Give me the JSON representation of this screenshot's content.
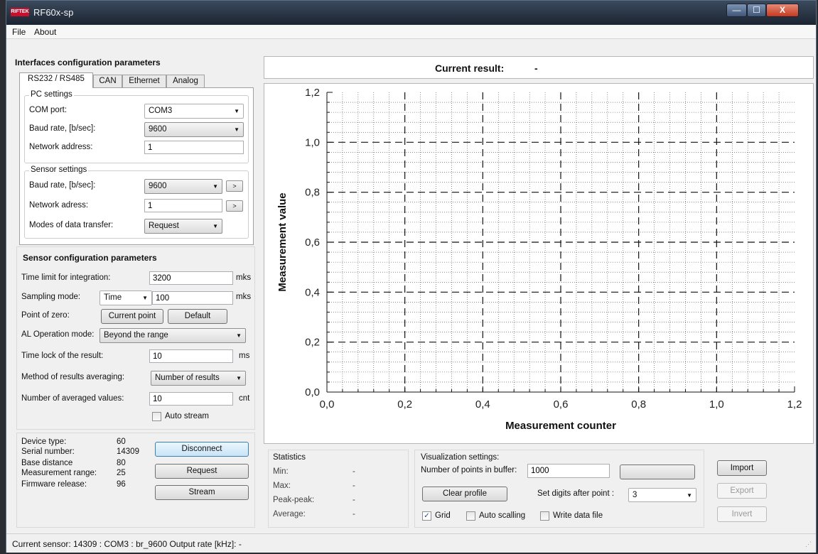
{
  "window": {
    "title": "RF60x-sp",
    "logo_text": "RIFTEK",
    "controls": {
      "min": "—",
      "max": "☐",
      "close": "X"
    }
  },
  "menu": {
    "file": "File",
    "about": "About"
  },
  "interfaces": {
    "heading": "Interfaces configuration parameters",
    "tabs": [
      "RS232 / RS485",
      "CAN",
      "Ethernet",
      "Analog"
    ],
    "pc_settings": {
      "title": "PC settings",
      "com_port_label": "COM port:",
      "com_port_value": "COM3",
      "baud_label": "Baud rate, [b/sec]:",
      "baud_value": "9600",
      "network_address_label": "Network address:",
      "network_address_value": "1"
    },
    "sensor_settings": {
      "title": "Sensor settings",
      "baud_label": "Baud rate, [b/sec]:",
      "baud_value": "9600",
      "network_adress_label": "Network adress:",
      "network_adress_value": "1",
      "modes_label": "Modes of data transfer:",
      "modes_value": "Request",
      "apply_glyph": ">"
    }
  },
  "sensor_config": {
    "heading": "Sensor configuration parameters",
    "time_limit_label": "Time limit for integration:",
    "time_limit_value": "3200",
    "time_limit_unit": "mks",
    "sampling_label": "Sampling mode:",
    "sampling_mode": "Time",
    "sampling_value": "100",
    "sampling_unit": "mks",
    "zero_label": "Point of zero:",
    "current_point_btn": "Current point",
    "default_btn": "Default",
    "al_label": "AL Operation mode:",
    "al_value": "Beyond the range",
    "time_lock_label": "Time lock of the result:",
    "time_lock_value": "10",
    "time_lock_unit": "ms",
    "averaging_label": "Method of results averaging:",
    "averaging_value": "Number of results",
    "avg_count_label": "Number of averaged values:",
    "avg_count_value": "10",
    "avg_count_unit": "cnt",
    "auto_stream_label": "Auto stream"
  },
  "device": {
    "type_label": "Device type:",
    "type_value": "60",
    "serial_label": "Serial number:",
    "serial_value": "14309",
    "base_label": "Base distance",
    "base_value": "80",
    "range_label": "Measurement range:",
    "range_value": "25",
    "firmware_label": "Firmware release:",
    "firmware_value": "96",
    "disconnect_btn": "Disconnect",
    "request_btn": "Request",
    "stream_btn": "Stream"
  },
  "current_result": {
    "label": "Current result:",
    "value": "-"
  },
  "chart_data": {
    "type": "line",
    "xlabel": "Measurement counter",
    "ylabel": "Measurement value",
    "xlim": [
      0,
      1.2
    ],
    "ylim": [
      0,
      1.2
    ],
    "x_ticks": [
      "0,0",
      "0,2",
      "0,4",
      "0,6",
      "0,8",
      "1,0",
      "1,2"
    ],
    "y_ticks": [
      "0,0",
      "0,2",
      "0,4",
      "0,6",
      "0,8",
      "1,0",
      "1,2"
    ],
    "grid": true,
    "series": []
  },
  "statistics": {
    "title": "Statistics",
    "min_label": "Min:",
    "min_value": "-",
    "max_label": "Max:",
    "max_value": "-",
    "peak_label": "Peak-peak:",
    "peak_value": "-",
    "avg_label": "Average:",
    "avg_value": "-"
  },
  "visualization": {
    "title": "Visualization settings:",
    "points_label": "Number of points in buffer:",
    "points_value": "1000",
    "clear_btn": "Clear profile",
    "digits_label": "Set digits after point :",
    "digits_value": "3",
    "grid_label": "Grid",
    "autoscale_label": "Auto scalling",
    "write_label": "Write data file"
  },
  "actions": {
    "import": "Import",
    "export": "Export",
    "invert": "Invert"
  },
  "status": {
    "text": "Current sensor:  14309 : COM3 : br_9600  Output rate [kHz]:  -"
  }
}
